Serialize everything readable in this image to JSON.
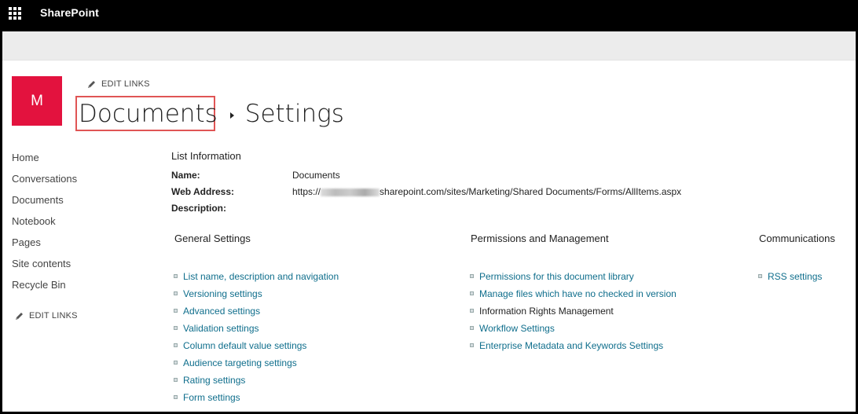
{
  "topbar": {
    "app_launcher_icon": "waffle-icon",
    "brand": "SharePoint"
  },
  "site": {
    "logo_letter": "M",
    "logo_color": "#e3123e"
  },
  "edit_links_label": "EDIT LINKS",
  "breadcrumb": {
    "list_name": "Documents",
    "separator_icon": "triangle-right-icon",
    "page": "Settings"
  },
  "left_nav": {
    "items": [
      "Home",
      "Conversations",
      "Documents",
      "Notebook",
      "Pages",
      "Site contents",
      "Recycle Bin"
    ],
    "edit_links": "EDIT LINKS"
  },
  "list_information": {
    "heading": "List Information",
    "name_label": "Name:",
    "name_value": "Documents",
    "web_address_label": "Web Address:",
    "web_address_prefix": "https://",
    "web_address_suffix": "sharepoint.com/sites/Marketing/Shared Documents/Forms/AllItems.aspx",
    "description_label": "Description:"
  },
  "sections": {
    "general": {
      "heading": "General Settings",
      "links": [
        "List name, description and navigation",
        "Versioning settings",
        "Advanced settings",
        "Validation settings",
        "Column default value settings",
        "Audience targeting settings",
        "Rating settings",
        "Form settings"
      ]
    },
    "permissions": {
      "heading": "Permissions and Management",
      "links": [
        "Permissions for this document library",
        "Manage files which have no checked in version",
        "Information Rights Management",
        "Workflow Settings",
        "Enterprise Metadata and Keywords Settings"
      ]
    },
    "communications": {
      "heading": "Communications",
      "links": [
        "RSS settings"
      ]
    }
  },
  "colors": {
    "link": "#0f6e8c",
    "highlight_box": "#e05555"
  }
}
